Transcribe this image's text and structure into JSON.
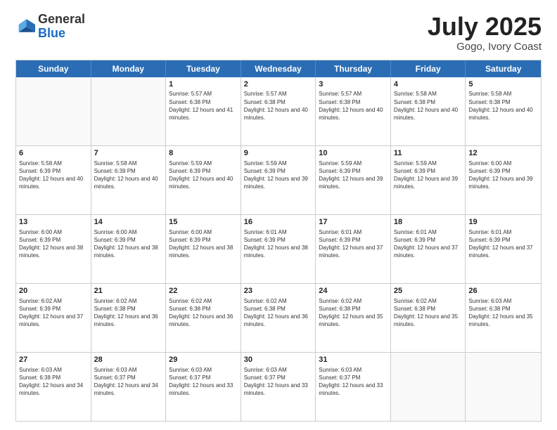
{
  "header": {
    "logo_general": "General",
    "logo_blue": "Blue",
    "title": "July 2025",
    "subtitle": "Gogo, Ivory Coast"
  },
  "calendar": {
    "days": [
      "Sunday",
      "Monday",
      "Tuesday",
      "Wednesday",
      "Thursday",
      "Friday",
      "Saturday"
    ],
    "weeks": [
      [
        {
          "day": "",
          "info": ""
        },
        {
          "day": "",
          "info": ""
        },
        {
          "day": "1",
          "info": "Sunrise: 5:57 AM\nSunset: 6:38 PM\nDaylight: 12 hours and 41 minutes."
        },
        {
          "day": "2",
          "info": "Sunrise: 5:57 AM\nSunset: 6:38 PM\nDaylight: 12 hours and 40 minutes."
        },
        {
          "day": "3",
          "info": "Sunrise: 5:57 AM\nSunset: 6:38 PM\nDaylight: 12 hours and 40 minutes."
        },
        {
          "day": "4",
          "info": "Sunrise: 5:58 AM\nSunset: 6:38 PM\nDaylight: 12 hours and 40 minutes."
        },
        {
          "day": "5",
          "info": "Sunrise: 5:58 AM\nSunset: 6:38 PM\nDaylight: 12 hours and 40 minutes."
        }
      ],
      [
        {
          "day": "6",
          "info": "Sunrise: 5:58 AM\nSunset: 6:39 PM\nDaylight: 12 hours and 40 minutes."
        },
        {
          "day": "7",
          "info": "Sunrise: 5:58 AM\nSunset: 6:39 PM\nDaylight: 12 hours and 40 minutes."
        },
        {
          "day": "8",
          "info": "Sunrise: 5:59 AM\nSunset: 6:39 PM\nDaylight: 12 hours and 40 minutes."
        },
        {
          "day": "9",
          "info": "Sunrise: 5:59 AM\nSunset: 6:39 PM\nDaylight: 12 hours and 39 minutes."
        },
        {
          "day": "10",
          "info": "Sunrise: 5:59 AM\nSunset: 6:39 PM\nDaylight: 12 hours and 39 minutes."
        },
        {
          "day": "11",
          "info": "Sunrise: 5:59 AM\nSunset: 6:39 PM\nDaylight: 12 hours and 39 minutes."
        },
        {
          "day": "12",
          "info": "Sunrise: 6:00 AM\nSunset: 6:39 PM\nDaylight: 12 hours and 39 minutes."
        }
      ],
      [
        {
          "day": "13",
          "info": "Sunrise: 6:00 AM\nSunset: 6:39 PM\nDaylight: 12 hours and 38 minutes."
        },
        {
          "day": "14",
          "info": "Sunrise: 6:00 AM\nSunset: 6:39 PM\nDaylight: 12 hours and 38 minutes."
        },
        {
          "day": "15",
          "info": "Sunrise: 6:00 AM\nSunset: 6:39 PM\nDaylight: 12 hours and 38 minutes."
        },
        {
          "day": "16",
          "info": "Sunrise: 6:01 AM\nSunset: 6:39 PM\nDaylight: 12 hours and 38 minutes."
        },
        {
          "day": "17",
          "info": "Sunrise: 6:01 AM\nSunset: 6:39 PM\nDaylight: 12 hours and 37 minutes."
        },
        {
          "day": "18",
          "info": "Sunrise: 6:01 AM\nSunset: 6:39 PM\nDaylight: 12 hours and 37 minutes."
        },
        {
          "day": "19",
          "info": "Sunrise: 6:01 AM\nSunset: 6:39 PM\nDaylight: 12 hours and 37 minutes."
        }
      ],
      [
        {
          "day": "20",
          "info": "Sunrise: 6:02 AM\nSunset: 6:39 PM\nDaylight: 12 hours and 37 minutes."
        },
        {
          "day": "21",
          "info": "Sunrise: 6:02 AM\nSunset: 6:38 PM\nDaylight: 12 hours and 36 minutes."
        },
        {
          "day": "22",
          "info": "Sunrise: 6:02 AM\nSunset: 6:38 PM\nDaylight: 12 hours and 36 minutes."
        },
        {
          "day": "23",
          "info": "Sunrise: 6:02 AM\nSunset: 6:38 PM\nDaylight: 12 hours and 36 minutes."
        },
        {
          "day": "24",
          "info": "Sunrise: 6:02 AM\nSunset: 6:38 PM\nDaylight: 12 hours and 35 minutes."
        },
        {
          "day": "25",
          "info": "Sunrise: 6:02 AM\nSunset: 6:38 PM\nDaylight: 12 hours and 35 minutes."
        },
        {
          "day": "26",
          "info": "Sunrise: 6:03 AM\nSunset: 6:38 PM\nDaylight: 12 hours and 35 minutes."
        }
      ],
      [
        {
          "day": "27",
          "info": "Sunrise: 6:03 AM\nSunset: 6:38 PM\nDaylight: 12 hours and 34 minutes."
        },
        {
          "day": "28",
          "info": "Sunrise: 6:03 AM\nSunset: 6:37 PM\nDaylight: 12 hours and 34 minutes."
        },
        {
          "day": "29",
          "info": "Sunrise: 6:03 AM\nSunset: 6:37 PM\nDaylight: 12 hours and 33 minutes."
        },
        {
          "day": "30",
          "info": "Sunrise: 6:03 AM\nSunset: 6:37 PM\nDaylight: 12 hours and 33 minutes."
        },
        {
          "day": "31",
          "info": "Sunrise: 6:03 AM\nSunset: 6:37 PM\nDaylight: 12 hours and 33 minutes."
        },
        {
          "day": "",
          "info": ""
        },
        {
          "day": "",
          "info": ""
        }
      ]
    ]
  }
}
